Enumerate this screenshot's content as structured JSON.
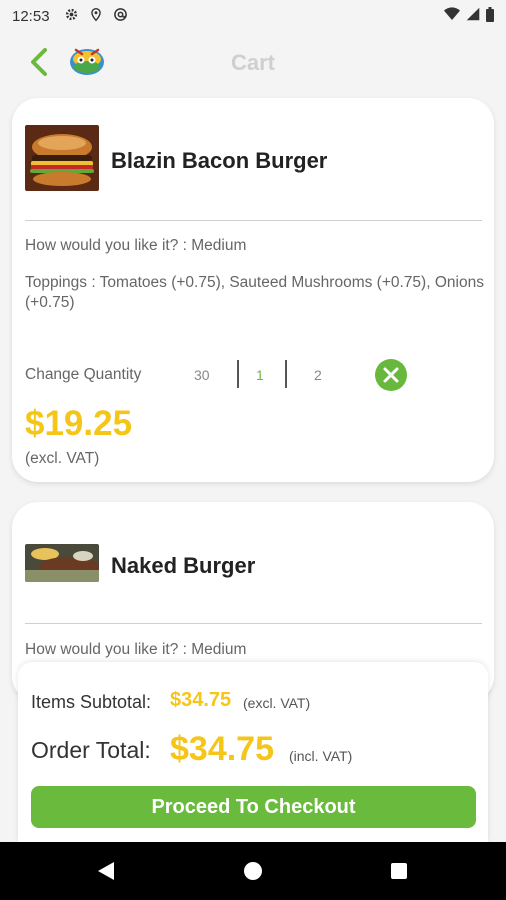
{
  "status_bar": {
    "time": "12:53",
    "left_icons": [
      "gear-icon",
      "location-icon",
      "at-sign-icon"
    ],
    "right_icons": [
      "wifi-icon",
      "signal-icon",
      "battery-icon"
    ]
  },
  "header": {
    "title": "Cart",
    "back_icon": "chevron-left-icon",
    "logo": "restaurant-logo"
  },
  "cart_items": [
    {
      "name": "Blazin Bacon Burger",
      "how": "How would you like it? : Medium",
      "toppings": "Toppings : Tomatoes (+0.75), Sauteed Mushrooms (+0.75), Onions (+0.75)",
      "quantity_label": "Change Quantity",
      "quantity_prev": "30",
      "quantity": "1",
      "quantity_next": "2",
      "price": "$19.25",
      "vat_note": "(excl. VAT)"
    },
    {
      "name": "Naked Burger",
      "how": "How would you like it? : Medium"
    }
  ],
  "summary": {
    "subtotal_label": "Items Subtotal:",
    "subtotal_value": "$34.75",
    "subtotal_note": "(excl. VAT)",
    "total_label": "Order Total:",
    "total_value": "$34.75",
    "total_note": "(incl. VAT)",
    "checkout_label": "Proceed To Checkout"
  },
  "colors": {
    "accent_green": "#6aba3d",
    "price_yellow": "#f5c518"
  },
  "nav_bar": [
    "nav-back-icon",
    "nav-home-icon",
    "nav-recents-icon"
  ]
}
